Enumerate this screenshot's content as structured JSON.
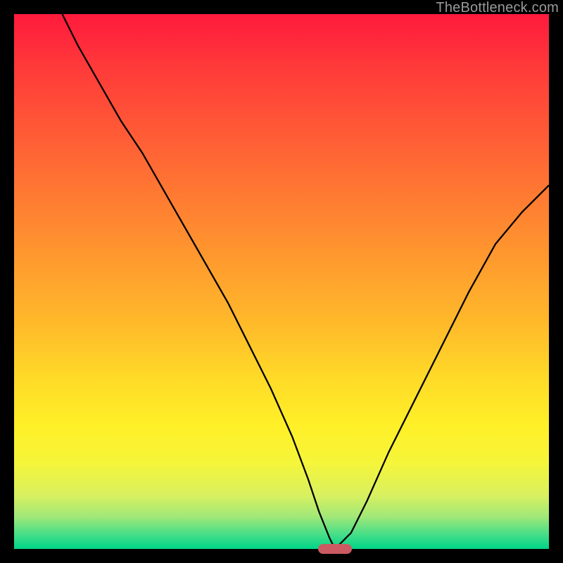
{
  "watermark": "TheBottleneck.com",
  "chart_data": {
    "type": "line",
    "title": "",
    "xlabel": "",
    "ylabel": "",
    "xlim": [
      0,
      100
    ],
    "ylim": [
      0,
      100
    ],
    "grid": false,
    "background_gradient": {
      "top_color": "#ff1a3c",
      "bottom_color": "#00d488",
      "description": "vertical red-to-green gradient"
    },
    "series": [
      {
        "name": "bottleneck-curve",
        "x": [
          9,
          12,
          16,
          20,
          24,
          28,
          32,
          36,
          40,
          44,
          48,
          52,
          55,
          57,
          59,
          60,
          61,
          63,
          66,
          70,
          75,
          80,
          85,
          90,
          95,
          100
        ],
        "values": [
          100,
          94,
          87,
          80,
          74,
          67,
          60,
          53,
          46,
          38,
          30,
          21,
          13,
          7,
          2,
          0,
          1,
          3,
          9,
          18,
          28,
          38,
          48,
          57,
          63,
          68
        ]
      }
    ],
    "marker": {
      "name": "optimal-point",
      "x": 60,
      "y": 0,
      "width_pct": 6.3,
      "color": "#cc5a62"
    }
  }
}
